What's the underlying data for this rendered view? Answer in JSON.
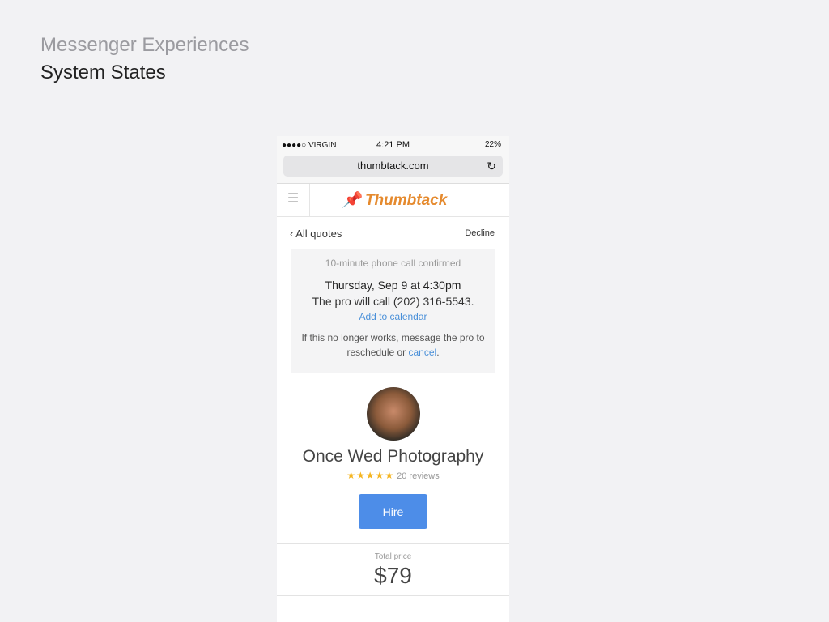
{
  "header": {
    "title": "Messenger Experiences",
    "subtitle": "System States"
  },
  "status": {
    "carrier": "●●●●○ VIRGIN",
    "wifi": "wifi-icon",
    "time": "4:21 PM",
    "battery": "22%"
  },
  "browser": {
    "url": "thumbtack.com",
    "reload_icon": "reload-icon"
  },
  "nav": {
    "menu_icon": "hamburger-icon",
    "brand": "Thumbtack",
    "brand_color": "#e58a2e"
  },
  "subnav": {
    "back_label": "All quotes",
    "decline_label": "Decline"
  },
  "confirmation": {
    "caption": "10-minute phone call confirmed",
    "datetime": "Thursday, Sep 9 at 4:30pm",
    "call_line": "The pro will call (202) 316-5543.",
    "add_calendar": "Add to calendar",
    "note_prefix": "If this no longer works, message the pro to reschedule or ",
    "note_link": "cancel",
    "note_suffix": "."
  },
  "pro": {
    "name": "Once Wed Photography",
    "rating": 5,
    "reviews": "20 reviews",
    "hire_label": "Hire",
    "accent": "#4d8de8"
  },
  "pricing": {
    "label": "Total price",
    "amount": "$79"
  }
}
